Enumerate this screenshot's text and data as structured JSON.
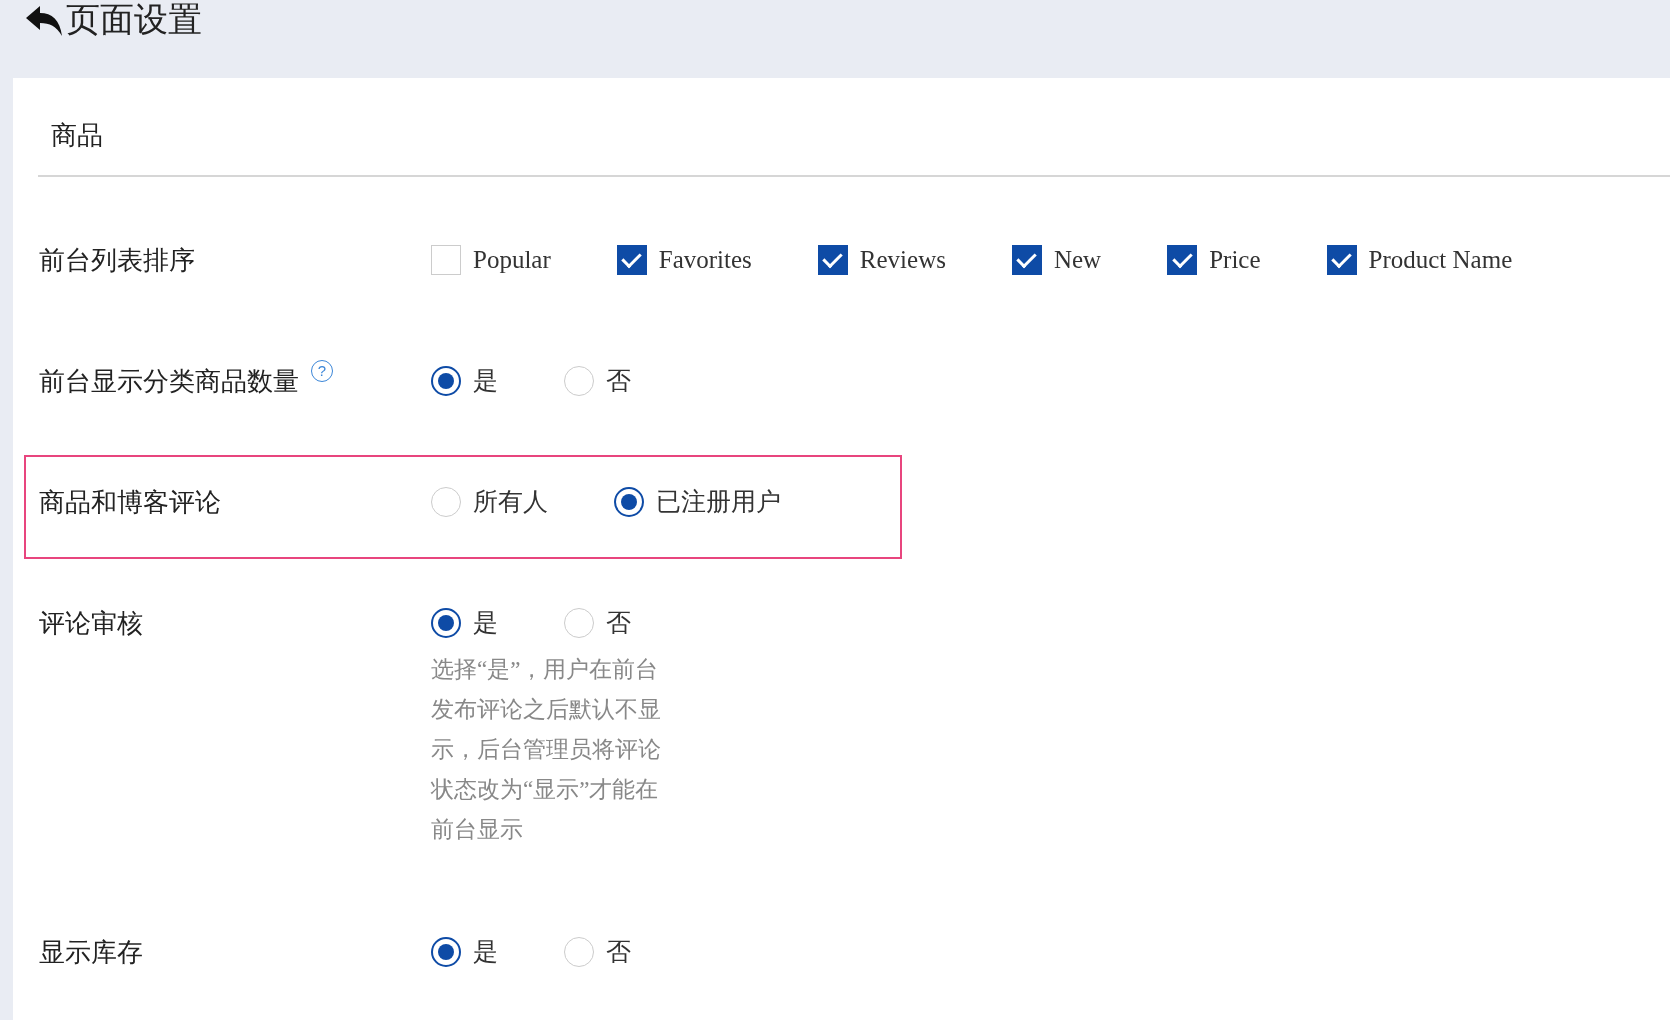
{
  "header": {
    "title": "页面设置"
  },
  "section": {
    "title": "商品"
  },
  "rows": [
    {
      "label": "前台列表排序",
      "kind": "checkbox",
      "highlighted": false,
      "options": [
        {
          "label": "Popular",
          "checked": false
        },
        {
          "label": "Favorites",
          "checked": true
        },
        {
          "label": "Reviews",
          "checked": true
        },
        {
          "label": "New",
          "checked": true
        },
        {
          "label": "Price",
          "checked": true
        },
        {
          "label": "Product Name",
          "checked": true
        }
      ]
    },
    {
      "label": "前台显示分类商品数量",
      "kind": "radio",
      "help_icon": "?",
      "highlighted": false,
      "options": [
        {
          "label": "是",
          "selected": true
        },
        {
          "label": "否",
          "selected": false
        }
      ]
    },
    {
      "label": "商品和博客评论",
      "kind": "radio",
      "highlighted": true,
      "options": [
        {
          "label": "所有人",
          "selected": false
        },
        {
          "label": "已注册用户",
          "selected": true
        }
      ]
    },
    {
      "label": "评论审核",
      "kind": "radio",
      "highlighted": false,
      "options": [
        {
          "label": "是",
          "selected": true
        },
        {
          "label": "否",
          "selected": false
        }
      ],
      "help_text": "选择“是”，用户在前台发布评论之后默认不显示，后台管理员将评论状态改为“显示”才能在前台显示"
    },
    {
      "label": "显示库存",
      "kind": "radio",
      "highlighted": false,
      "options": [
        {
          "label": "是",
          "selected": true
        },
        {
          "label": "否",
          "selected": false
        }
      ]
    }
  ]
}
